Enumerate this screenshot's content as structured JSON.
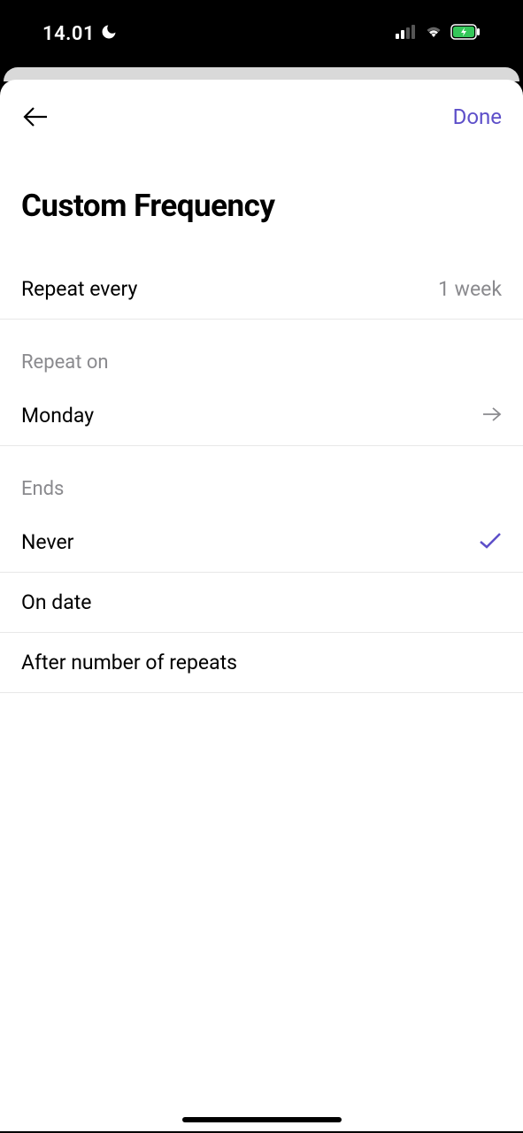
{
  "statusBar": {
    "time": "14.01"
  },
  "nav": {
    "doneLabel": "Done"
  },
  "title": "Custom Frequency",
  "repeatEvery": {
    "label": "Repeat every",
    "value": "1 week"
  },
  "repeatOn": {
    "header": "Repeat on",
    "value": "Monday"
  },
  "ends": {
    "header": "Ends",
    "options": [
      {
        "label": "Never",
        "selected": true
      },
      {
        "label": "On date",
        "selected": false
      },
      {
        "label": "After number of repeats",
        "selected": false
      }
    ]
  }
}
